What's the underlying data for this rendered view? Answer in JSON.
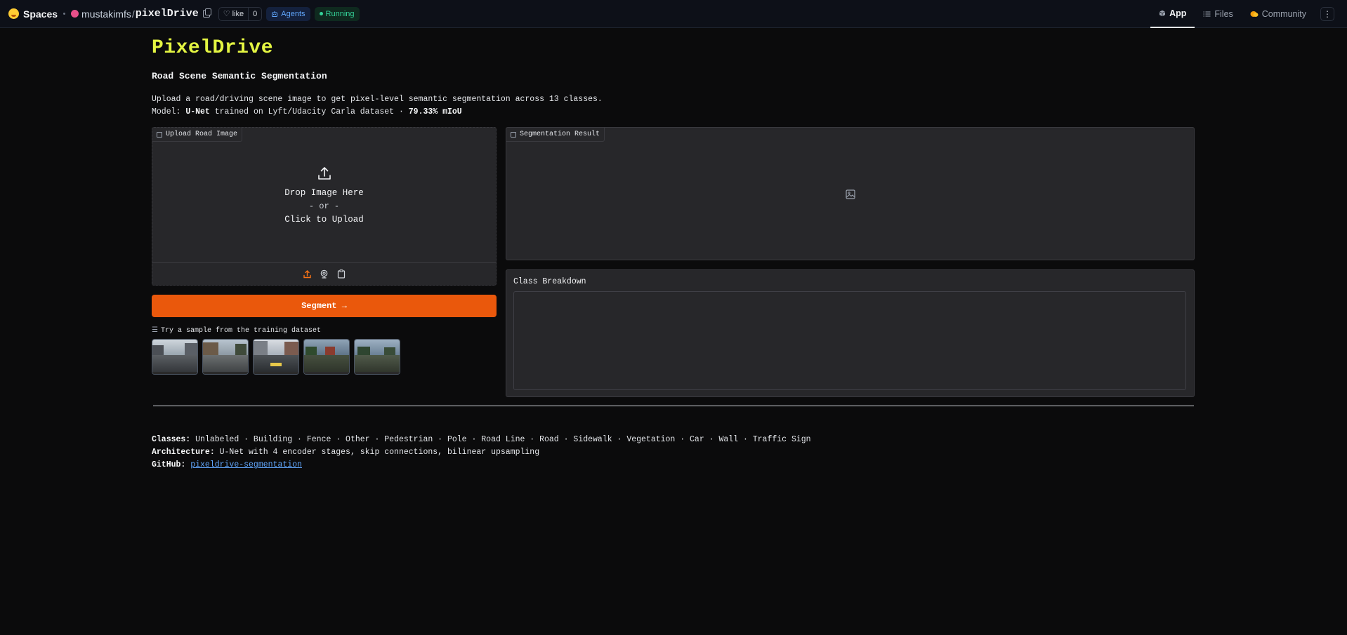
{
  "topbar": {
    "brand": "Spaces",
    "owner": "mustakimfs",
    "repo_name": "pixelDrive",
    "like_label": "like",
    "like_count": "0",
    "agents_label": "Agents",
    "status_label": "Running",
    "tabs": [
      {
        "label": "App",
        "icon": "cube-icon",
        "active": true
      },
      {
        "label": "Files",
        "icon": "files-icon",
        "active": false
      },
      {
        "label": "Community",
        "icon": "community-icon",
        "active": false
      }
    ],
    "more_icon": "⋮"
  },
  "main": {
    "title": "PixelDrive",
    "subtitle": "Road Scene Semantic Segmentation",
    "desc_line1": "Upload a road/driving scene image to get pixel-level semantic segmentation across 13 classes.",
    "desc_line2_prefix": "Model: ",
    "desc_line2_model": "U-Net",
    "desc_line2_mid": " trained on Lyft/Udacity Carla dataset · ",
    "desc_line2_score": "79.33% mIoU"
  },
  "upload": {
    "label": "Upload Road Image",
    "drop_text": "Drop Image Here",
    "or_text": "- or -",
    "click_text": "Click to Upload"
  },
  "segment_button": "Segment →",
  "samples": {
    "label": "Try a sample from the training dataset",
    "count": 5
  },
  "segmentation": {
    "label": "Segmentation Result"
  },
  "breakdown": {
    "title": "Class Breakdown"
  },
  "footer": {
    "classes_label": "Classes:",
    "classes_value": " Unlabeled · Building · Fence · Other · Pedestrian · Pole · Road Line · Road · Sidewalk · Vegetation · Car · Wall · Traffic Sign",
    "arch_label": "Architecture:",
    "arch_value": " U-Net with 4 encoder stages, skip connections, bilinear upsampling",
    "github_label": "GitHub:",
    "github_link": "pixeldrive-segmentation"
  },
  "colors": {
    "accent": "#ea580c",
    "title": "#e4f542",
    "link": "#60a5fa",
    "running": "#34d399"
  }
}
